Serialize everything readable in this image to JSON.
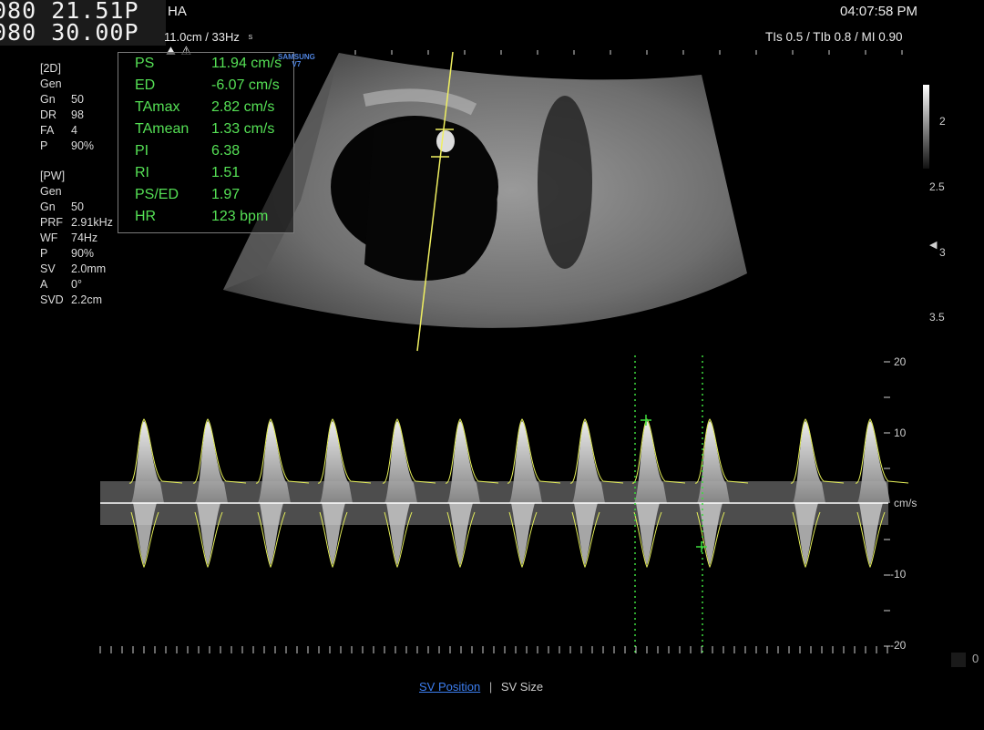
{
  "header": {
    "line1": "080 21.51P",
    "line2": "080 30.00P",
    "mode": "HA",
    "depth_freq": "11.0cm / 33Hz",
    "time": "04:07:58 PM",
    "tis": "TIs  0.5 / TIb  0.8 / MI  0.90"
  },
  "logo": {
    "brand": "SAMSUNG",
    "model": "V7"
  },
  "params_2d": [
    {
      "k": "[2D]",
      "v": ""
    },
    {
      "k": "Gen",
      "v": ""
    },
    {
      "k": "Gn",
      "v": "50"
    },
    {
      "k": "DR",
      "v": "98"
    },
    {
      "k": "FA",
      "v": "4"
    },
    {
      "k": "P",
      "v": "90%"
    }
  ],
  "params_pw": [
    {
      "k": "[PW]",
      "v": ""
    },
    {
      "k": "Gen",
      "v": ""
    },
    {
      "k": "Gn",
      "v": "50"
    },
    {
      "k": "PRF",
      "v": "2.91kHz"
    },
    {
      "k": "WF",
      "v": "74Hz"
    },
    {
      "k": "P",
      "v": "90%"
    },
    {
      "k": "SV",
      "v": "2.0mm"
    },
    {
      "k": "A",
      "v": "0°"
    },
    {
      "k": "SVD",
      "v": "2.2cm"
    }
  ],
  "measurements": [
    {
      "label": "PS",
      "value": "11.94 cm/s"
    },
    {
      "label": "ED",
      "value": "-6.07 cm/s"
    },
    {
      "label": "TAmax",
      "value": "2.82 cm/s"
    },
    {
      "label": "TAmean",
      "value": "1.33 cm/s"
    },
    {
      "label": "PI",
      "value": "6.38"
    },
    {
      "label": "RI",
      "value": "1.51"
    },
    {
      "label": "PS/ED",
      "value": "1.97"
    },
    {
      "label": "HR",
      "value": "123 bpm"
    }
  ],
  "depth_scale": [
    "2",
    "2.5",
    "3",
    "3.5"
  ],
  "velocity_scale": {
    "unit": "cm/s",
    "labels": [
      "20",
      "10",
      "-10",
      "-20"
    ]
  },
  "bottom": {
    "sv_position": "SV Position",
    "separator": "|",
    "sv_size": "SV Size",
    "zero": "0"
  },
  "colors": {
    "measure_text": "#55e055",
    "trace": "#e6f05a",
    "calipers": "#3ddc3d",
    "tab": "#3c7ef0"
  }
}
